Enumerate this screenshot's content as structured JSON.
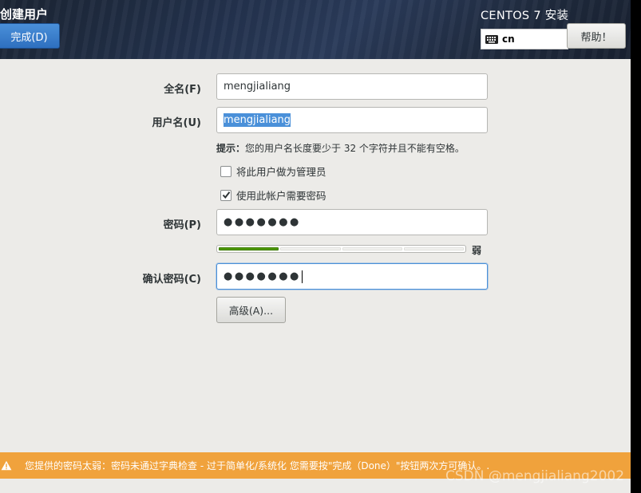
{
  "header": {
    "page_title": "创建用户",
    "done_label": "完成(D)",
    "install_title": "CENTOS 7 安装",
    "keyboard_layout": "cn",
    "help_label": "帮助！"
  },
  "form": {
    "fullname_label": "全名(F)",
    "fullname_value": "mengjialiang",
    "username_label": "用户名(U)",
    "username_value": "mengjialiang",
    "hint_bold": "提示：",
    "hint_text": "您的用户名长度要少于 32 个字符并且不能有空格。",
    "admin_checkbox_label": "将此用户做为管理员",
    "admin_checked": false,
    "require_password_label": "使用此帐户需要密码",
    "require_password_checked": true,
    "password_label": "密码(P)",
    "password_masked": "●●●●●●●",
    "strength_level": 0.25,
    "strength_label": "弱",
    "confirm_label": "确认密码(C)",
    "confirm_masked": "●●●●●●●",
    "advanced_label": "高级(A)..."
  },
  "warning": {
    "text": "您提供的密码太弱：密码未通过字典检查 - 过于简单化/系统化 您需要按\"完成（Done）\"按钮两次方可确认。."
  },
  "watermark": "CSDN @mengjialiang2002",
  "colors": {
    "accent": "#4a90d9",
    "warning": "#f0a23c",
    "strength": "#4e9a06"
  }
}
